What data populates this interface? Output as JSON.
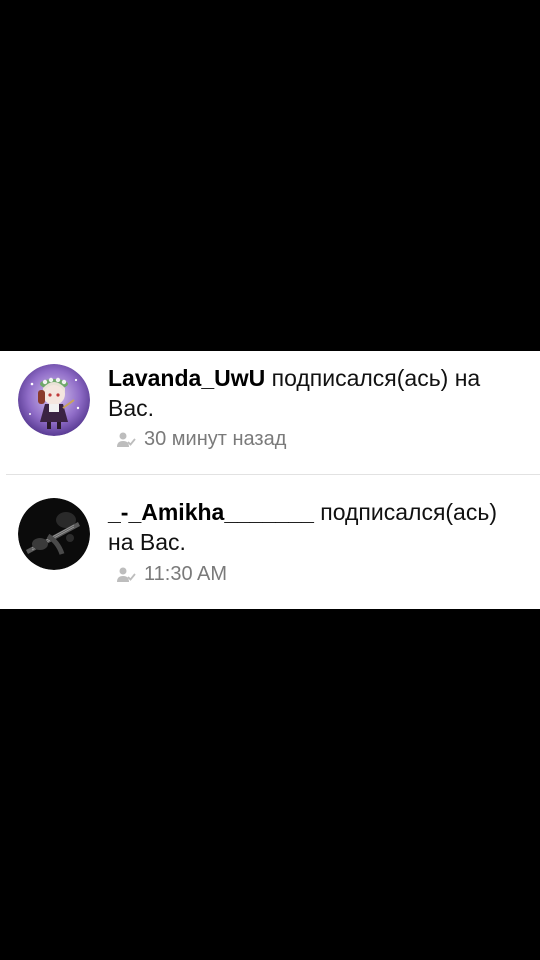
{
  "notifications": [
    {
      "username": "Lavanda_UwU",
      "action": " подписался(ась) на Вас.",
      "time": "30 минут назад",
      "avatar_icon": "anime-character-avatar",
      "time_icon": "user-check-icon"
    },
    {
      "username": "_-_Amikha_______",
      "action": " подписался(ась) на Вас.",
      "time": "11:30 AM",
      "avatar_icon": "dark-guitar-photo-avatar",
      "time_icon": "user-check-icon"
    }
  ],
  "colors": {
    "background": "#000000",
    "panel": "#ffffff",
    "meta_text": "#7a7a7a",
    "divider": "#e2e2e2"
  }
}
